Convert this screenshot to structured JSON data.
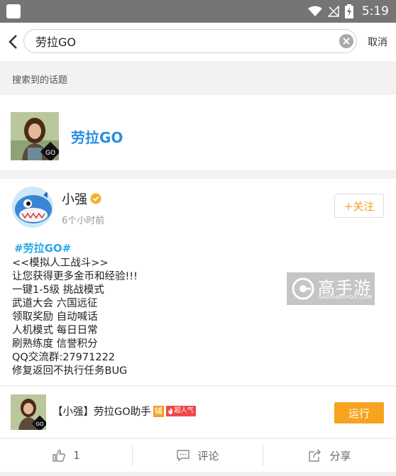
{
  "status_bar": {
    "time": "5:19"
  },
  "search": {
    "query": "劳拉GO",
    "cancel_label": "取消"
  },
  "section": {
    "label": "搜索到的话题"
  },
  "topic": {
    "name": "劳拉GO",
    "avatar_badge": "GO"
  },
  "post": {
    "username": "小强",
    "time": "6个小时前",
    "follow_label": "+关注",
    "hashtag": "#劳拉GO#",
    "lines": [
      "<<模拟人工战斗>>",
      "让您获得更多金币和经验!!!",
      "一键1-5级 挑战模式",
      "武道大会  六国远征",
      "领取奖励  自动喊话",
      "人机模式  每日日常",
      "刷熟练度  信誉积分",
      "QQ交流群:27971222",
      "修复返回不执行任务BUG"
    ],
    "watermark": {
      "text": "高手游",
      "sub": "GAOSHOUYOU.COM"
    }
  },
  "app": {
    "title": "【小强】劳拉GO助手",
    "badge_fu": "辅",
    "badge_hot": "超人气",
    "run_label": "运行",
    "icon_badge": "GO"
  },
  "actions": {
    "like_count": "1",
    "comment_label": "评论",
    "share_label": "分享"
  },
  "colors": {
    "accent": "#f7a31f",
    "link": "#2a8fe0",
    "hashtag": "#2aa7e6"
  }
}
